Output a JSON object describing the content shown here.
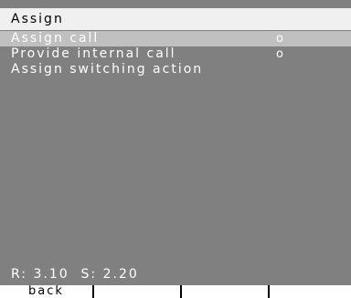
{
  "title": "Assign",
  "menu": [
    {
      "label": "Assign call",
      "marker": "o",
      "selected": true
    },
    {
      "label": "Provide internal call",
      "marker": "o",
      "selected": false
    },
    {
      "label": "Assign switching action",
      "marker": "",
      "selected": false
    }
  ],
  "status": "R: 3.10  S: 2.20",
  "softkeys": [
    "back",
    "",
    "",
    ""
  ],
  "colors": {
    "background": "#808080",
    "title_bg": "#f0f0f0",
    "selected_bg": "#c0c0c0",
    "text": "#ffffff"
  }
}
